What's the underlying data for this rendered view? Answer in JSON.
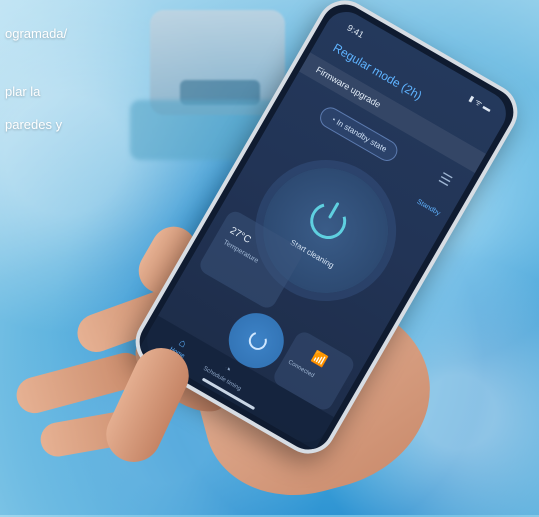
{
  "overlay_text": {
    "line1": "ogramada/",
    "line2": "plar la",
    "line3": "paredes y"
  },
  "phone": {
    "status_time": "9:41",
    "status_icons": "▮ ᯤ ▬",
    "mode_title": "Regular mode (2h)",
    "firmware_label": "Firmware upgrade",
    "standby_text": "In standby state",
    "standby_link": "Standby",
    "start_label": "Start cleaning",
    "temperature_value": "27°C",
    "temperature_label": "Temperature",
    "connection_label": "Connected",
    "tabs": [
      {
        "icon": "⌂",
        "label": "Home"
      },
      {
        "icon": "◔",
        "label": "Schedule timing"
      }
    ]
  },
  "colors": {
    "accent": "#5fb3ff",
    "power_ring": "#5fd0e0",
    "screen_bg": "#223456"
  }
}
